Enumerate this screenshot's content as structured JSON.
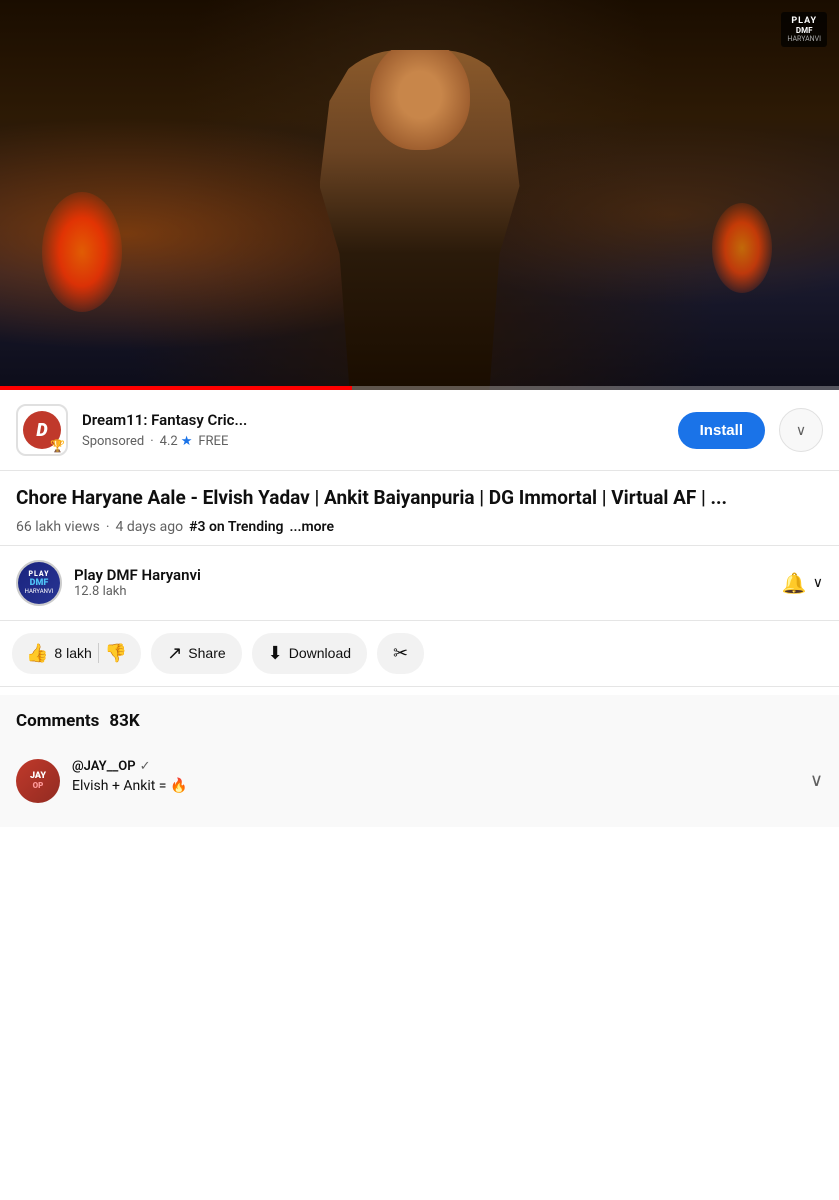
{
  "video": {
    "thumbnail_alt": "Music video still frame",
    "progress_percent": 42,
    "watermark": {
      "play": "PLAY",
      "dmf": "DMF",
      "haryanvi": "HARYANVI"
    }
  },
  "ad": {
    "title": "Dream11: Fantasy Cric...",
    "sponsored_label": "Sponsored",
    "separator": "·",
    "rating": "4.2",
    "star": "★",
    "free_label": "FREE",
    "install_label": "Install",
    "chevron": "∨"
  },
  "video_info": {
    "title": "Chore Haryane Aale - Elvish Yadav | Ankit Baiyanpuria | DG Immortal | Virtual AF | ...",
    "views": "66 lakh views",
    "time_ago": "4 days ago",
    "trending": "#3 on Trending",
    "more_label": "...more"
  },
  "channel": {
    "name": "Play DMF Haryanvi",
    "subscribers": "12.8 lakh",
    "bell_icon": "🔔",
    "chevron": "∨"
  },
  "actions": {
    "like_count": "8 lakh",
    "like_icon": "👍",
    "dislike_icon": "👎",
    "share_icon": "↗",
    "share_label": "Share",
    "download_icon": "⬇",
    "download_label": "Download",
    "clip_icon": "✂"
  },
  "comments": {
    "title": "Comments",
    "count": "83K",
    "items": [
      {
        "username": "@JAY__OP",
        "verified": true,
        "avatar_text": "JAY\nOP",
        "text": "Elvish + Ankit = 🔥",
        "avatar_color1": "#c0392b",
        "avatar_color2": "#922b21"
      }
    ]
  }
}
